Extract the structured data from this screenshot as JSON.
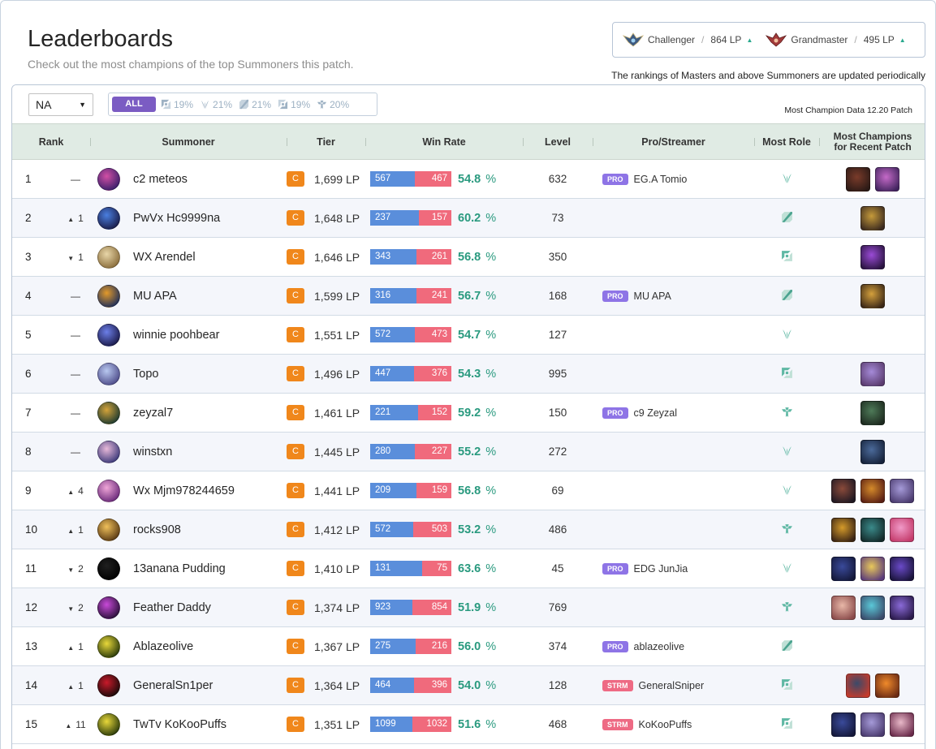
{
  "page": {
    "title": "Leaderboards",
    "subtitle": "Check out the most champions of the top Summoners this patch.",
    "notice": "The rankings of Masters and above Summoners are updated periodically"
  },
  "cutoffs": [
    {
      "tier": "Challenger",
      "lp": "864 LP",
      "emblem": "challenger-emblem-icon",
      "color": "#3d5a80"
    },
    {
      "tier": "Grandmaster",
      "lp": "495 LP",
      "emblem": "grandmaster-emblem-icon",
      "color": "#a23a3a"
    }
  ],
  "filters": {
    "region": "NA",
    "all_label": "ALL",
    "roles": [
      {
        "icon": "top-role-icon",
        "pct": "19%"
      },
      {
        "icon": "jungle-role-icon",
        "pct": "21%"
      },
      {
        "icon": "mid-role-icon",
        "pct": "21%"
      },
      {
        "icon": "bot-role-icon",
        "pct": "19%"
      },
      {
        "icon": "support-role-icon",
        "pct": "20%"
      }
    ],
    "patch_note": "Most Champion Data 12.20 Patch"
  },
  "columns": {
    "rank": "Rank",
    "summoner": "Summoner",
    "tier": "Tier",
    "winrate": "Win Rate",
    "level": "Level",
    "pro": "Pro/Streamer",
    "role": "Most Role",
    "champs_line1": "Most Champions",
    "champs_line2": "for Recent Patch"
  },
  "colors": {
    "accent": "#7b5cc3",
    "wins": "#5a8edb",
    "losses": "#f06a7c",
    "tier": "#f0871b",
    "positive": "#2aa98e",
    "negative": "#e05a66",
    "header_bg": "#e0ebe4"
  },
  "rows": [
    {
      "rank": "1",
      "dir": "none",
      "delta": "—",
      "name": "c2 meteos",
      "avatar": [
        "#d24fa5",
        "#3b1f6b"
      ],
      "tier": "C",
      "lp": "1,699 LP",
      "wins": "567",
      "losses": "467",
      "w": 567,
      "l": 467,
      "wr": "54.8",
      "level": "632",
      "tag": "PRO",
      "pro": "EG.A Tomio",
      "role": "jungle-role-icon",
      "champs": [
        [
          "#7a3b2a",
          "#2b1a16"
        ],
        [
          "#c56ac8",
          "#41245e"
        ]
      ]
    },
    {
      "rank": "2",
      "dir": "up",
      "delta": "1",
      "name": "PwVx Hc9999na",
      "avatar": [
        "#4a7fe0",
        "#1a1d4a"
      ],
      "tier": "C",
      "lp": "1,648 LP",
      "wins": "237",
      "losses": "157",
      "w": 237,
      "l": 157,
      "wr": "60.2",
      "level": "73",
      "tag": "",
      "pro": "",
      "role": "mid-role-icon",
      "champs": [
        [
          "#c59a3a",
          "#3b2a1f"
        ]
      ]
    },
    {
      "rank": "3",
      "dir": "down",
      "delta": "1",
      "name": "WX Arendel",
      "avatar": [
        "#e8d6a8",
        "#8a6d3b"
      ],
      "tier": "C",
      "lp": "1,646 LP",
      "wins": "343",
      "losses": "261",
      "w": 343,
      "l": 261,
      "wr": "56.8",
      "level": "350",
      "tag": "",
      "pro": "",
      "role": "top-role-icon",
      "champs": [
        [
          "#9a4bd6",
          "#2a1440"
        ]
      ]
    },
    {
      "rank": "4",
      "dir": "none",
      "delta": "—",
      "name": "MU APA",
      "avatar": [
        "#e39a2a",
        "#1f2f5a"
      ],
      "tier": "C",
      "lp": "1,599 LP",
      "wins": "316",
      "losses": "241",
      "w": 316,
      "l": 241,
      "wr": "56.7",
      "level": "168",
      "tag": "PRO",
      "pro": "MU APA",
      "role": "mid-role-icon",
      "champs": [
        [
          "#d4a03c",
          "#3a2716"
        ]
      ]
    },
    {
      "rank": "5",
      "dir": "none",
      "delta": "—",
      "name": "winnie poohbear",
      "avatar": [
        "#6c7fe8",
        "#1b1a4a"
      ],
      "tier": "C",
      "lp": "1,551 LP",
      "wins": "572",
      "losses": "473",
      "w": 572,
      "l": 473,
      "wr": "54.7",
      "level": "127",
      "tag": "",
      "pro": "",
      "role": "jungle-role-icon",
      "champs": []
    },
    {
      "rank": "6",
      "dir": "none",
      "delta": "—",
      "name": "Topo",
      "avatar": [
        "#b8c8f0",
        "#4e4c8a"
      ],
      "tier": "C",
      "lp": "1,496 LP",
      "wins": "447",
      "losses": "376",
      "w": 447,
      "l": 376,
      "wr": "54.3",
      "level": "995",
      "tag": "",
      "pro": "",
      "role": "top-role-icon",
      "champs": [
        [
          "#a58ad8",
          "#5a3b6e"
        ]
      ]
    },
    {
      "rank": "7",
      "dir": "none",
      "delta": "—",
      "name": "zeyzal7",
      "avatar": [
        "#d4a33a",
        "#1d3a2f"
      ],
      "tier": "C",
      "lp": "1,461 LP",
      "wins": "221",
      "losses": "152",
      "w": 221,
      "l": 152,
      "wr": "59.2",
      "level": "150",
      "tag": "PRO",
      "pro": "c9 Zeyzal",
      "role": "support-role-icon",
      "champs": [
        [
          "#4e7a58",
          "#1d2a1f"
        ]
      ]
    },
    {
      "rank": "8",
      "dir": "none",
      "delta": "—",
      "name": "winstxn",
      "avatar": [
        "#e8b9d9",
        "#3c3a7a"
      ],
      "tier": "C",
      "lp": "1,445 LP",
      "wins": "280",
      "losses": "227",
      "w": 280,
      "l": 227,
      "wr": "55.2",
      "level": "272",
      "tag": "",
      "pro": "",
      "role": "jungle-role-icon",
      "champs": [
        [
          "#4b6a9a",
          "#16223a"
        ]
      ]
    },
    {
      "rank": "9",
      "dir": "up",
      "delta": "4",
      "name": "Wx Mjm978244659",
      "avatar": [
        "#f0a6d8",
        "#6a2a7a"
      ],
      "tier": "C",
      "lp": "1,441 LP",
      "wins": "209",
      "losses": "159",
      "w": 209,
      "l": 159,
      "wr": "56.8",
      "level": "69",
      "tag": "",
      "pro": "",
      "role": "jungle-role-icon",
      "champs": [
        [
          "#8a4a3a",
          "#1f1822"
        ],
        [
          "#d48a2a",
          "#5a1f14"
        ],
        [
          "#a59ad8",
          "#4a3a6e"
        ]
      ]
    },
    {
      "rank": "10",
      "dir": "up",
      "delta": "1",
      "name": "rocks908",
      "avatar": [
        "#f0c05a",
        "#5a3a14"
      ],
      "tier": "C",
      "lp": "1,412 LP",
      "wins": "572",
      "losses": "503",
      "w": 572,
      "l": 503,
      "wr": "53.2",
      "level": "486",
      "tag": "",
      "pro": "",
      "role": "support-role-icon",
      "champs": [
        [
          "#d49a2a",
          "#3a2414"
        ],
        [
          "#3a8a8a",
          "#142a2a"
        ],
        [
          "#f09ac8",
          "#c43a6a"
        ]
      ]
    },
    {
      "rank": "11",
      "dir": "down",
      "delta": "2",
      "name": "13anana Pudding",
      "avatar": [
        "#202020",
        "#000000"
      ],
      "tier": "C",
      "lp": "1,410 LP",
      "wins": "131",
      "losses": "75",
      "w": 131,
      "l": 75,
      "wr": "63.6",
      "level": "45",
      "tag": "PRO",
      "pro": "EDG JunJia",
      "role": "jungle-role-icon",
      "champs": [
        [
          "#3a4a9a",
          "#14183a"
        ],
        [
          "#e8c85a",
          "#5a3a7a"
        ],
        [
          "#6a4ac8",
          "#1a143a"
        ]
      ]
    },
    {
      "rank": "12",
      "dir": "down",
      "delta": "2",
      "name": "Feather Daddy",
      "avatar": [
        "#c84ad8",
        "#2a103a"
      ],
      "tier": "C",
      "lp": "1,374 LP",
      "wins": "923",
      "losses": "854",
      "w": 923,
      "l": 854,
      "wr": "51.9",
      "level": "769",
      "tag": "",
      "pro": "",
      "role": "support-role-icon",
      "champs": [
        [
          "#e8b8a8",
          "#8a4a4a"
        ],
        [
          "#5ac8d8",
          "#3a4a6a"
        ],
        [
          "#8a6ad8",
          "#2a1a4a"
        ]
      ]
    },
    {
      "rank": "13",
      "dir": "up",
      "delta": "1",
      "name": "Ablazeolive",
      "avatar": [
        "#e8d83a",
        "#2a3a0a"
      ],
      "tier": "C",
      "lp": "1,367 LP",
      "wins": "275",
      "losses": "216",
      "w": 275,
      "l": 216,
      "wr": "56.0",
      "level": "374",
      "tag": "PRO",
      "pro": "ablazeolive",
      "role": "mid-role-icon",
      "champs": []
    },
    {
      "rank": "14",
      "dir": "up",
      "delta": "1",
      "name": "GeneralSn1per",
      "avatar": [
        "#c81a2a",
        "#1a0a0a"
      ],
      "tier": "C",
      "lp": "1,364 LP",
      "wins": "464",
      "losses": "396",
      "w": 464,
      "l": 396,
      "wr": "54.0",
      "level": "128",
      "tag": "STRM",
      "pro": "GeneralSniper",
      "role": "top-role-icon",
      "champs": [
        [
          "#3a4a6a",
          "#c83a2a"
        ],
        [
          "#f08a2a",
          "#6a2a14"
        ]
      ]
    },
    {
      "rank": "15",
      "dir": "up",
      "delta": "11",
      "name": "TwTv KoKooPuffs",
      "avatar": [
        "#e8d83a",
        "#2a3a0a"
      ],
      "tier": "C",
      "lp": "1,351 LP",
      "wins": "1099",
      "losses": "1032",
      "w": 1099,
      "l": 1032,
      "wr": "51.6",
      "level": "468",
      "tag": "STRM",
      "pro": "KoKooPuffs",
      "role": "top-role-icon",
      "champs": [
        [
          "#3a4a9a",
          "#14183a"
        ],
        [
          "#a59ad8",
          "#4a3a6e"
        ],
        [
          "#e8b8c8",
          "#6a2a4a"
        ]
      ]
    }
  ]
}
